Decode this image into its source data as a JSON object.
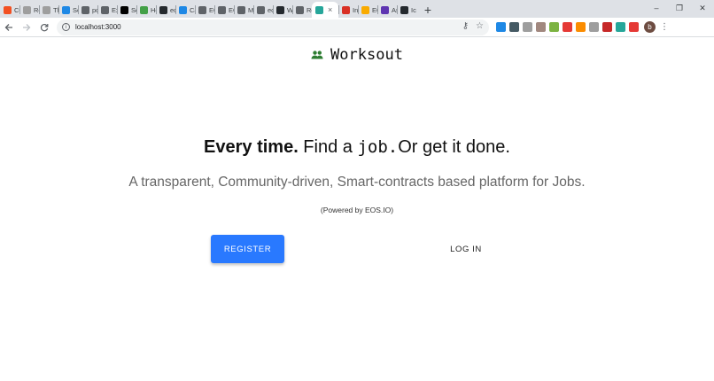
{
  "browser": {
    "tabs": [
      {
        "label": "CC",
        "color": "#f25022"
      },
      {
        "label": "Re",
        "color": "#9e9e9e"
      },
      {
        "label": "Th",
        "color": "#9e9e9e"
      },
      {
        "label": "Se",
        "color": "#1e88e5"
      },
      {
        "label": "pc",
        "color": "#5f6368"
      },
      {
        "label": "Ex",
        "color": "#5f6368"
      },
      {
        "label": "Sc",
        "color": "#000000"
      },
      {
        "label": "Hc",
        "color": "#43a047"
      },
      {
        "label": "ec",
        "color": "#24292e"
      },
      {
        "label": "Ca",
        "color": "#1e88e5"
      },
      {
        "label": "EC",
        "color": "#5f6368"
      },
      {
        "label": "EC",
        "color": "#5f6368"
      },
      {
        "label": "Mi",
        "color": "#5f6368"
      },
      {
        "label": "eo",
        "color": "#5f6368"
      },
      {
        "label": "Wi",
        "color": "#24292e"
      },
      {
        "label": "Re",
        "color": "#5f6368"
      },
      {
        "label": "×",
        "color": "#26a69a"
      },
      {
        "label": "Inl",
        "color": "#d93025"
      },
      {
        "label": "EC",
        "color": "#f9ab00"
      },
      {
        "label": "As",
        "color": "#5e35b1"
      },
      {
        "label": "Icc",
        "color": "#24292e"
      }
    ],
    "new_tab": "+",
    "window_controls": {
      "minimize": "–",
      "restore": "❐",
      "close": "✕"
    },
    "address": "localhost:3000",
    "extensions": [
      "#1e88e5",
      "#455a64",
      "#9e9e9e",
      "#a1887f",
      "#7cb342",
      "#e53935",
      "#fb8c00",
      "#9e9e9e",
      "#c62828",
      "#26a69a",
      "#e53935"
    ],
    "avatar": "b"
  },
  "page": {
    "brand": "Worksout",
    "headline": {
      "strong": "Every time.",
      "part1": " Find a ",
      "mono": "job.",
      "part2": "Or get it done."
    },
    "subline": "A transparent, Community-driven, Smart-contracts based platform for Jobs.",
    "powered": "(Powered by EOS.IO)",
    "register_label": "REGISTER",
    "login_label": "LOG IN",
    "colors": {
      "accent": "#2979ff",
      "brand_icon": "#2e7d32"
    }
  }
}
